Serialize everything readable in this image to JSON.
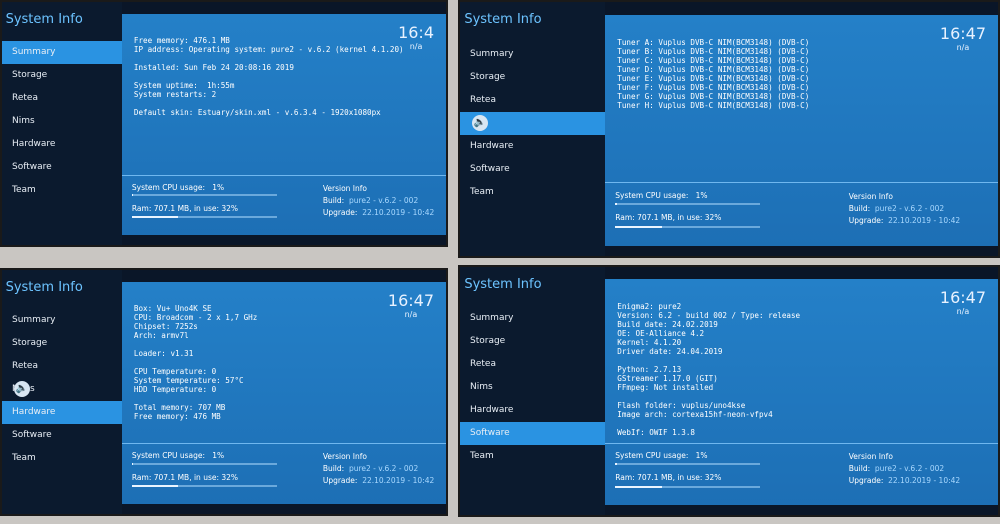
{
  "app_title": "System Info",
  "clock": "16:47",
  "clock_sub": "n/a",
  "menu": [
    "Summary",
    "Storage",
    "Retea",
    "Nims",
    "Hardware",
    "Software",
    "Team"
  ],
  "footer": {
    "cpu": "System CPU usage:",
    "cpu_value": "1%",
    "ram": "Ram: 707.1 MB, in use: 32%",
    "ram_pct": 32,
    "version_info": "Version Info",
    "build_label": "Build:",
    "build": "pure2 - v.6.2 - 002",
    "upgrade_label": "Upgrade:",
    "upgrade": "22.10.2019 - 10:42"
  },
  "screens": [
    {
      "selected": 0,
      "clock": "16:4",
      "lines": [
        "Free memory: 476.1 MB",
        "IP address: Operating system: pure2 - v.6.2 (kernel 4.1.20)",
        "",
        "Installed: Sun Feb 24 20:08:16 2019",
        "",
        "System uptime:  1h:55m",
        "System restarts: 2",
        "",
        "Default skin: Estuary/skin.xml - v.6.3.4 - 1920x1080px"
      ]
    },
    {
      "selected": 3,
      "cursor_on": 3,
      "lines": [
        "Tuner A: Vuplus DVB-C NIM(BCM3148) (DVB-C)",
        "Tuner B: Vuplus DVB-C NIM(BCM3148) (DVB-C)",
        "Tuner C: Vuplus DVB-C NIM(BCM3148) (DVB-C)",
        "Tuner D: Vuplus DVB-C NIM(BCM3148) (DVB-C)",
        "Tuner E: Vuplus DVB-C NIM(BCM3148) (DVB-C)",
        "Tuner F: Vuplus DVB-C NIM(BCM3148) (DVB-C)",
        "Tuner G: Vuplus DVB-C NIM(BCM3148) (DVB-C)",
        "Tuner H: Vuplus DVB-C NIM(BCM3148) (DVB-C)"
      ]
    },
    {
      "selected": 4,
      "cursor_on": 3,
      "lines": [
        "Box: Vu+ Uno4K SE",
        "CPU: Broadcom - 2 x 1,7 GHz",
        "Chipset: 7252s",
        "Arch: armv7l",
        "",
        "Loader: v1.31",
        "",
        "CPU Temperature: 0",
        "System temperature: 57°C",
        "HDD Temperature: 0",
        "",
        "Total memory: 707 MB",
        "Free memory: 476 MB"
      ]
    },
    {
      "selected": 5,
      "lines": [
        "Enigma2: pure2",
        "Version: 6.2 - build 002 / Type: release",
        "Build date: 24.02.2019",
        "OE: OE-Alliance 4.2",
        "Kernel: 4.1.20",
        "Driver date: 24.04.2019",
        "",
        "Python: 2.7.13",
        "GStreamer 1.17.0 (GIT)",
        "FFmpeg: Not installed",
        "",
        "Flash folder: vuplus/uno4kse",
        "Image arch: cortexa15hf-neon-vfpv4",
        "",
        "WebIf: OWIF 1.3.8"
      ]
    }
  ]
}
